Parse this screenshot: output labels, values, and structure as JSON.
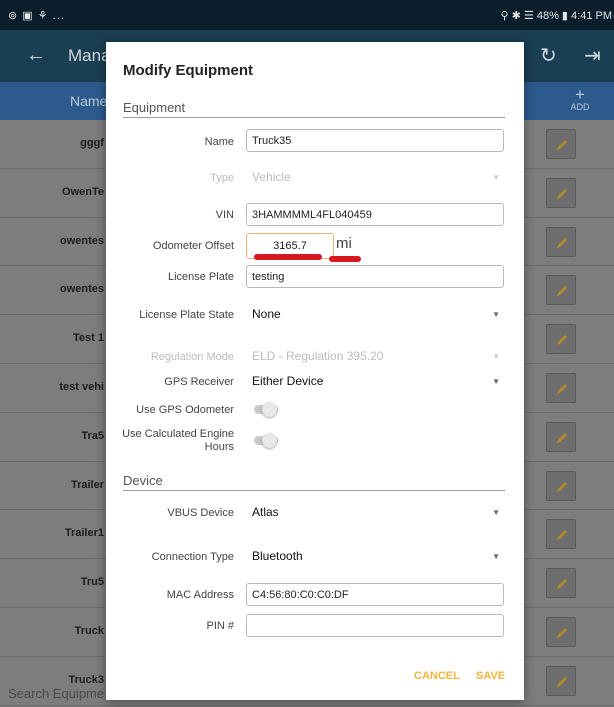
{
  "status": {
    "left": "⊚ ▣ ⚘ ...",
    "right": "⚲ ✱ ☰ 48% ▮ 4:41 PM"
  },
  "appbar": {
    "title": "Mana"
  },
  "table": {
    "name_header": "Name",
    "add_label": "ADD",
    "add_symbol": "+"
  },
  "rows": [
    "gggf",
    "OwenTe",
    "owentes",
    "owentes",
    "Test 1",
    "test vehi",
    "Tra5",
    "Trailer",
    "Trailer1",
    "Tru5",
    "Truck",
    "Truck3"
  ],
  "search_placeholder": "Search Equipme",
  "dialog": {
    "title": "Modify Equipment",
    "sections": {
      "equipment": "Equipment",
      "device": "Device"
    },
    "fields": {
      "name": {
        "label": "Name",
        "value": "Truck35"
      },
      "type": {
        "label": "Type",
        "value": "Vehicle"
      },
      "vin": {
        "label": "VIN",
        "value": "3HAMMMML4FL040459"
      },
      "odometer": {
        "label": "Odometer Offset",
        "value": "3165.7",
        "unit": "mi"
      },
      "license_plate": {
        "label": "License Plate",
        "value": "testing"
      },
      "license_plate_state": {
        "label": "License Plate State",
        "value": "None"
      },
      "regulation_mode": {
        "label": "Regulation Mode",
        "value": "ELD - Regulation 395.20"
      },
      "gps_receiver": {
        "label": "GPS Receiver",
        "value": "Either Device"
      },
      "use_gps_odometer": {
        "label": "Use GPS Odometer"
      },
      "use_calc_hours": {
        "label_line1": "Use Calculated Engine",
        "label_line2": "Hours"
      },
      "vbus_device": {
        "label": "VBUS Device",
        "value": "Atlas"
      },
      "connection_type": {
        "label": "Connection Type",
        "value": "Bluetooth"
      },
      "mac_address": {
        "label": "MAC Address",
        "value": "C4:56:80:C0:C0:DF"
      },
      "pin": {
        "label": "PIN #",
        "value": ""
      }
    },
    "actions": {
      "cancel": "CANCEL",
      "save": "SAVE"
    }
  },
  "colors": {
    "accent": "#f2b43c",
    "annotation_red": "#d81920",
    "appbar": "#1a3e52",
    "table_header": "#2c5a8d"
  }
}
